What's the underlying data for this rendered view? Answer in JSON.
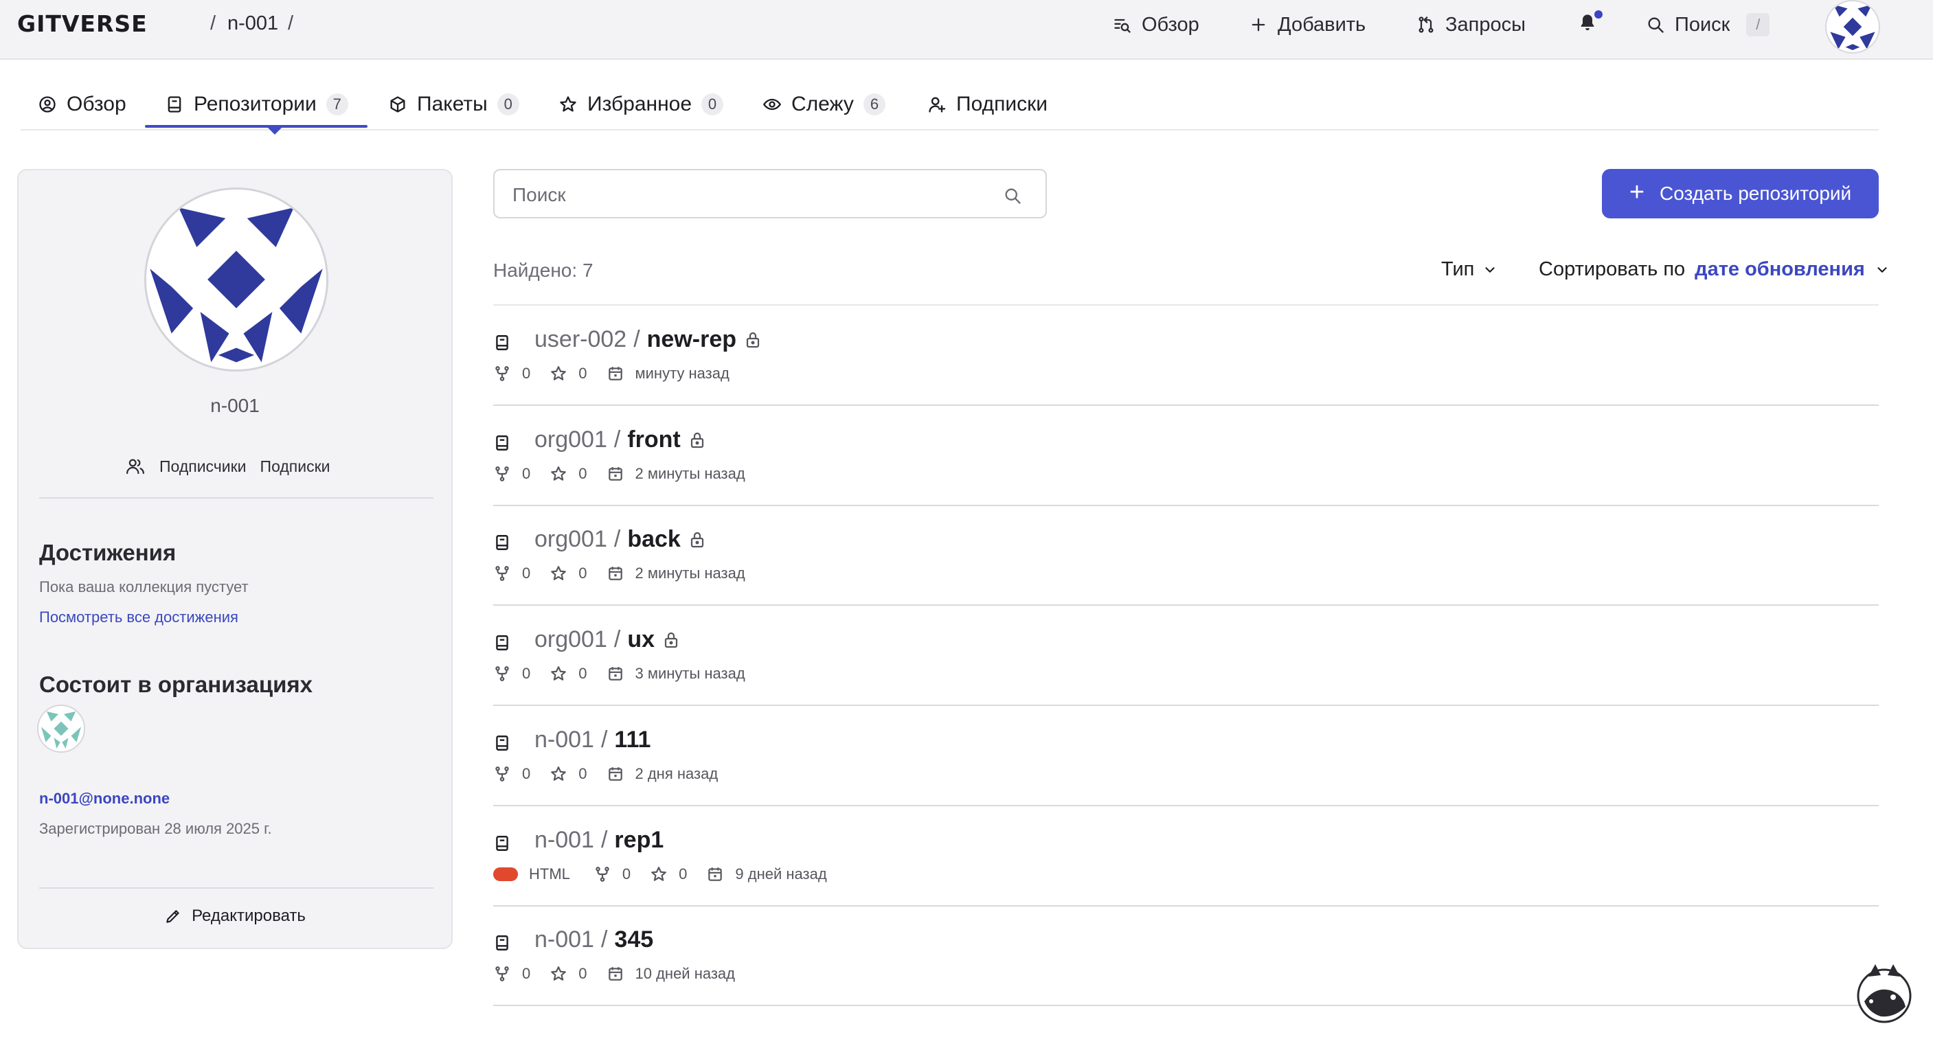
{
  "header": {
    "logo": "GITVERSE",
    "breadcrumb_sep_1": "/",
    "breadcrumb_user": "n-001",
    "breadcrumb_sep_2": "/",
    "nav": {
      "overview": "Обзор",
      "add": "Добавить",
      "requests": "Запросы",
      "search": "Поиск",
      "search_shortcut": "/"
    },
    "notification_dot_color": "#3c44c8"
  },
  "tabs": [
    {
      "label": "Обзор",
      "icon": "user-circle-icon"
    },
    {
      "label": "Репозитории",
      "count": "7",
      "icon": "book-icon",
      "active": true
    },
    {
      "label": "Пакеты",
      "count": "0",
      "icon": "package-icon"
    },
    {
      "label": "Избранное",
      "count": "0",
      "icon": "star-icon"
    },
    {
      "label": "Слежу",
      "count": "6",
      "icon": "eye-icon"
    },
    {
      "label": "Подписки",
      "icon": "user-plus-icon"
    }
  ],
  "profile": {
    "username": "n-001",
    "followers_label": "Подписчики",
    "following_label": "Подписки",
    "achievements_title": "Достижения",
    "achievements_empty": "Пока ваша коллекция пустует",
    "achievements_link": "Посмотреть все достижения",
    "orgs_title": "Состоит в организациях",
    "email": "n-001@none.none",
    "registered": "Зарегистрирован 28 июля 2025 г.",
    "edit_label": "Редактировать"
  },
  "main": {
    "search_placeholder": "Поиск",
    "create_button": "Создать репозиторий",
    "create_plus": "+",
    "found": "Найдено: 7",
    "type_label": "Тип",
    "sort_label": "Сортировать по",
    "sort_value": "дате обновления"
  },
  "repos": [
    {
      "owner": "user-002",
      "name": "new-rep",
      "private": true,
      "forks": "0",
      "stars": "0",
      "updated": "минуту назад"
    },
    {
      "owner": "org001",
      "name": "front",
      "private": true,
      "forks": "0",
      "stars": "0",
      "updated": "2 минуты назад"
    },
    {
      "owner": "org001",
      "name": "back",
      "private": true,
      "forks": "0",
      "stars": "0",
      "updated": "2 минуты назад"
    },
    {
      "owner": "org001",
      "name": "ux",
      "private": true,
      "forks": "0",
      "stars": "0",
      "updated": "3 минуты назад"
    },
    {
      "owner": "n-001",
      "name": "111",
      "private": false,
      "forks": "0",
      "stars": "0",
      "updated": "2 дня назад"
    },
    {
      "owner": "n-001",
      "name": "rep1",
      "private": false,
      "language": "HTML",
      "language_color": "#e0492d",
      "forks": "0",
      "stars": "0",
      "updated": "9 дней назад"
    },
    {
      "owner": "n-001",
      "name": "345",
      "private": false,
      "forks": "0",
      "stars": "0",
      "updated": "10 дней назад"
    }
  ],
  "colors": {
    "accent": "#4a55d4",
    "link": "#3b47c0",
    "avatar_pattern": "#2f3a9c"
  }
}
